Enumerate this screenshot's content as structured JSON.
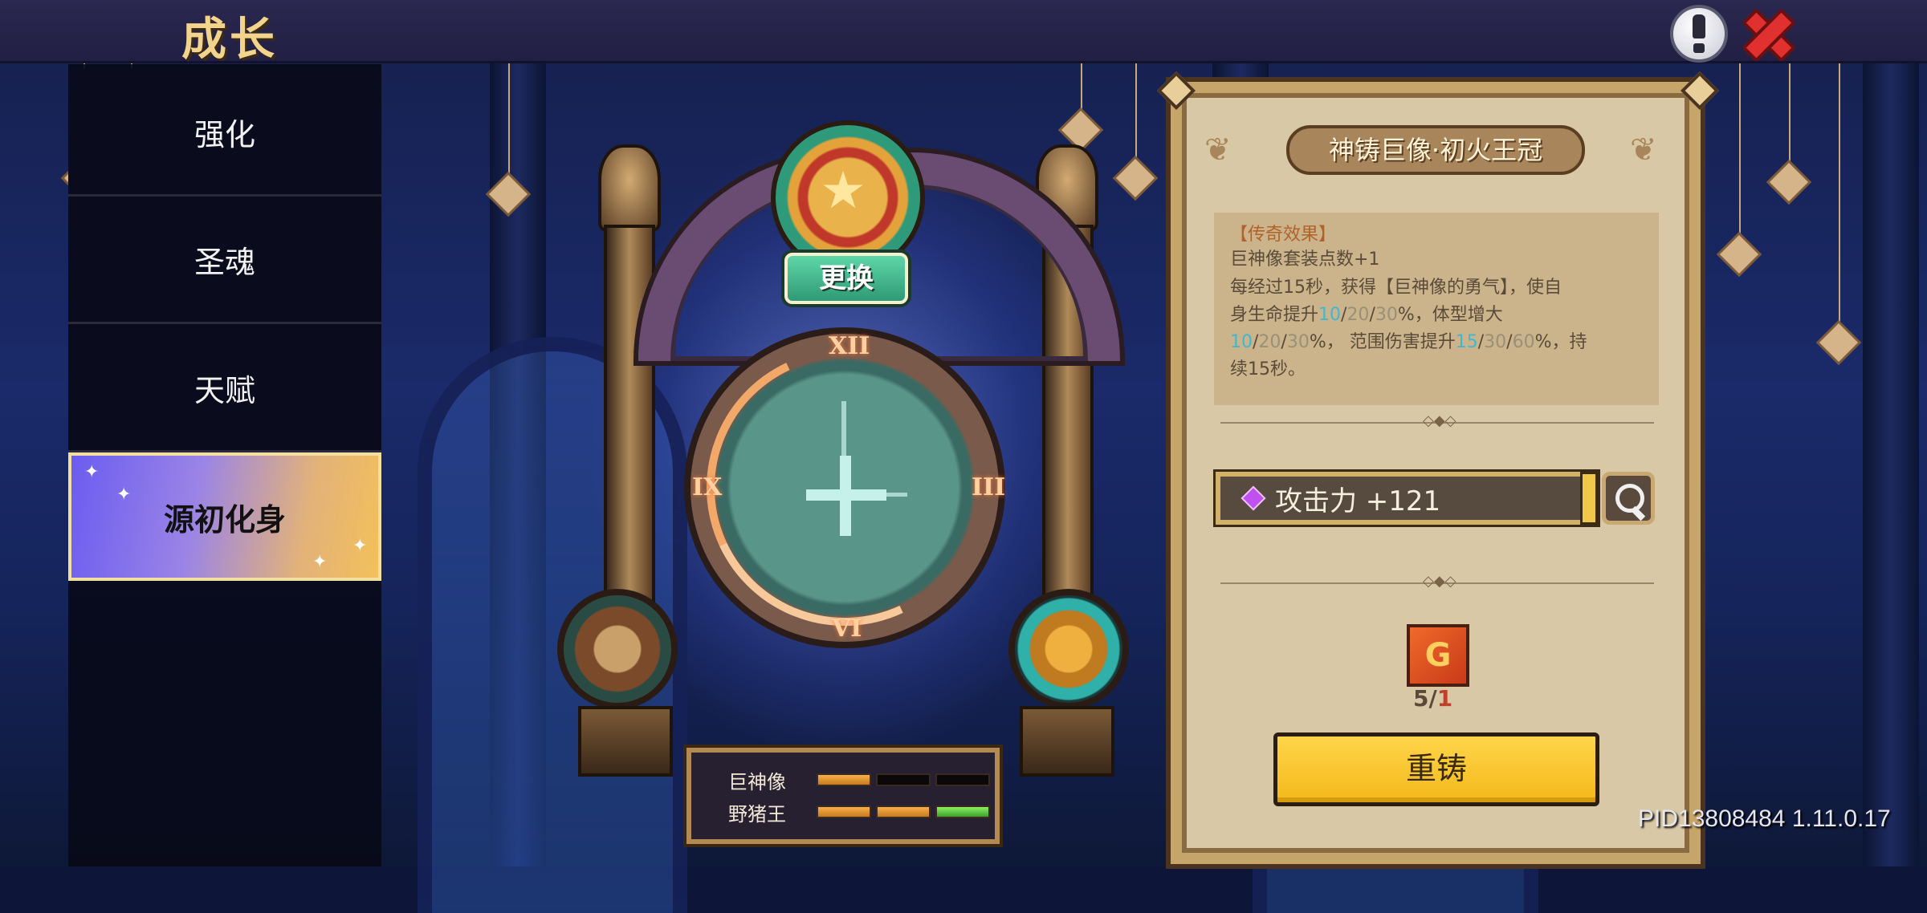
{
  "header": {
    "title": "成长"
  },
  "menu": {
    "items": [
      {
        "label": "强化",
        "active": false
      },
      {
        "label": "圣魂",
        "active": false
      },
      {
        "label": "天赋",
        "active": false
      },
      {
        "label": "源初化身",
        "active": true
      }
    ]
  },
  "statue": {
    "swap_label": "更换",
    "numerals": {
      "top": "XII",
      "right": "III",
      "bottom": "VI",
      "left": "IX"
    },
    "sets": [
      {
        "name": "巨神像",
        "segments_filled": 1,
        "segments_total": 3
      },
      {
        "name": "野猪王",
        "segments_filled": 3,
        "segments_total": 3
      }
    ]
  },
  "detail": {
    "item_name": "神铸巨像·初火王冠",
    "effect_title": "【传奇效果】",
    "effect_line1": "巨神像套装点数+1",
    "effect_line2_a": "每经过15秒，获得【巨神像的勇气】，使自",
    "effect_line3_a": "身生命提升",
    "effect_line3_v1": "10",
    "effect_line3_v2": "20",
    "effect_line3_v3": "30",
    "effect_line3_b": "%，体型增大",
    "effect_line4_v1": "10",
    "effect_line4_v2": "20",
    "effect_line4_v3": "30",
    "effect_line4_a": "%， 范围伤害提升",
    "effect_line4_v4": "15",
    "effect_line4_v5": "30",
    "effect_line4_v6": "60",
    "effect_line4_b": "%，持",
    "effect_line5": "续15秒。",
    "stat_text": "攻击力 +121",
    "material_count_have": "5/",
    "material_count_need": "1",
    "reforge_label": "重铸"
  },
  "footer": {
    "build_id": "PID13808484 1.11.0.17"
  },
  "colors": {
    "accent_gold": "#f4b81a",
    "active_tab_start": "#6b5cf0",
    "active_tab_end": "#f3c05a",
    "tier_blue": "#3fb8d0"
  },
  "icons": [
    "info-icon",
    "close-icon",
    "search-icon",
    "gem-icon",
    "material-icon",
    "star-emblem-icon"
  ]
}
